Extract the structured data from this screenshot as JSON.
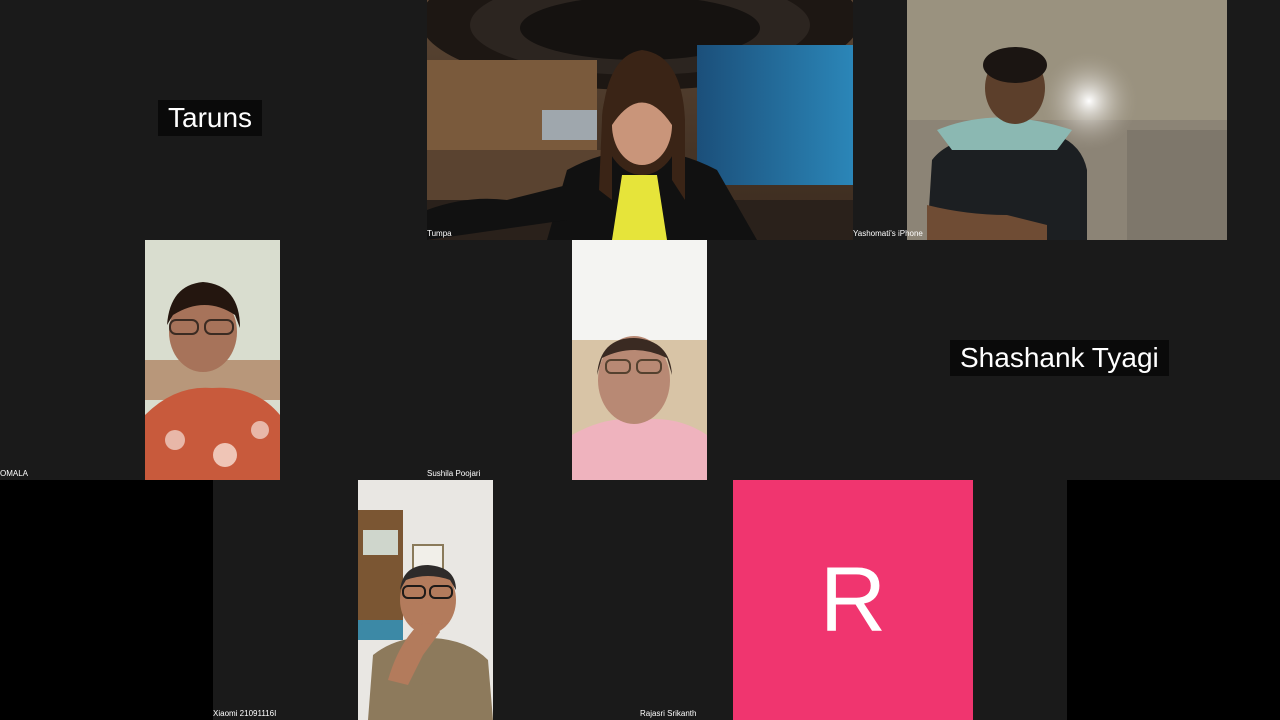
{
  "colors": {
    "background": "#1a1a1a",
    "avatar_bg": "#f0356f",
    "placard_bg": "#0a0a0a",
    "text": "#ffffff"
  },
  "participants": {
    "taruns": {
      "name": "Taruns"
    },
    "tumpa": {
      "name": "Tumpa"
    },
    "yashomati": {
      "name": "Yashomati's iPhone"
    },
    "omala": {
      "name": "OMALA"
    },
    "sushila": {
      "name": "Sushila Poojari"
    },
    "shashank": {
      "name": "Shashank Tyagi"
    },
    "xiaomi": {
      "name": "Xiaomi 21091116I"
    },
    "rajasri": {
      "name": "Rajasri Srikanth",
      "initial": "R"
    }
  }
}
